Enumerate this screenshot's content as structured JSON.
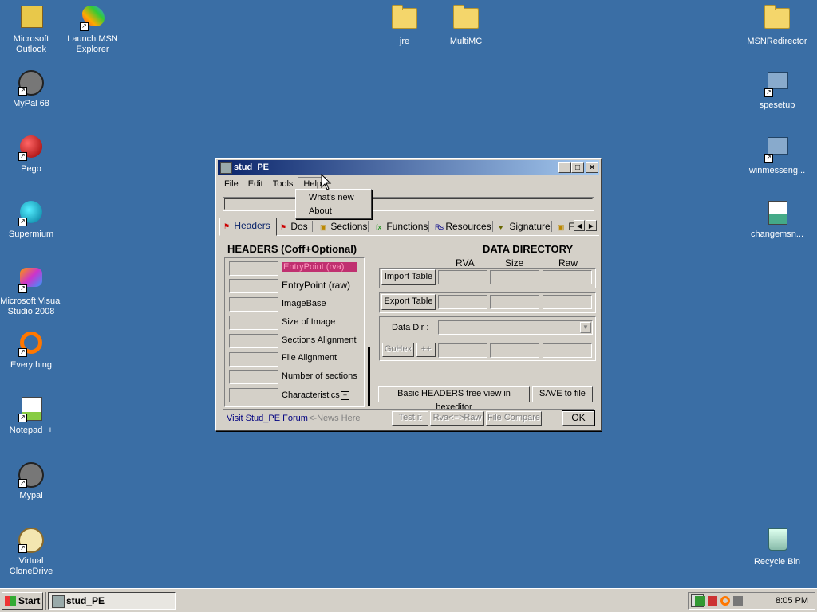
{
  "desktop": {
    "icons_left": [
      {
        "label": "Microsoft Outlook",
        "icon": "outlook-icon"
      },
      {
        "label": "Launch MSN Explorer",
        "icon": "msn-butterfly-icon"
      },
      {
        "label": "MyPal 68",
        "icon": "raccoon-icon"
      },
      {
        "label": "Pego",
        "icon": "red-ball-icon"
      },
      {
        "label": "Supermium",
        "icon": "supermium-icon"
      },
      {
        "label": "Microsoft Visual Studio 2008",
        "icon": "visual-studio-icon"
      },
      {
        "label": "Everything",
        "icon": "magnifier-icon"
      },
      {
        "label": "Notepad++",
        "icon": "notepadpp-icon"
      },
      {
        "label": "Mypal",
        "icon": "raccoon-icon"
      },
      {
        "label": "Virtual CloneDrive",
        "icon": "sheep-icon"
      }
    ],
    "icons_top": [
      {
        "label": "jre",
        "icon": "folder-icon"
      },
      {
        "label": "MultiMC",
        "icon": "folder-icon"
      }
    ],
    "icons_right": [
      {
        "label": "MSNRedirector",
        "icon": "folder-icon"
      },
      {
        "label": "spesetup",
        "icon": "installer-icon"
      },
      {
        "label": "winmesseng...",
        "icon": "installer-icon"
      },
      {
        "label": "changemsn...",
        "icon": "script-icon"
      },
      {
        "label": "Recycle Bin",
        "icon": "recycle-bin-icon"
      }
    ]
  },
  "window": {
    "title": "stud_PE",
    "controls": {
      "minimize": "_",
      "maximize": "□",
      "close": "×"
    },
    "menu": [
      "File",
      "Edit",
      "Tools",
      "Help"
    ],
    "help_menu": [
      "What's new",
      "About"
    ],
    "tabs": [
      "Headers",
      "Dos",
      "Sections",
      "Functions",
      "Resources",
      "Signature",
      "F"
    ],
    "headers_title": "HEADERS (Coff+Optional)",
    "header_fields": [
      "EntryPoint (rva)",
      "EntryPoint (raw)",
      "ImageBase",
      "Size of Image",
      "Sections Alignment",
      "File Alignment",
      "Number of sections",
      "Characteristics"
    ],
    "characteristics_expand": "+",
    "data_directory_title": "DATA  DIRECTORY",
    "dd_columns": [
      "RVA",
      "Size",
      "Raw"
    ],
    "import_table": "Import Table",
    "export_table": "Export Table",
    "data_dir_label": "Data Dir :",
    "gohex": "GoHex",
    "plusplus": "++",
    "basic_headers_btn": "Basic HEADERS tree view in hexeditor",
    "save_btn": "SAVE to file",
    "forum_link": "Visit Stud_PE Forum",
    "news": "<-News Here",
    "test_btn": "Test it",
    "rva_raw_btn": "Rva<=>Raw",
    "file_compare_btn": "File Compare",
    "ok_btn": "OK"
  },
  "taskbar": {
    "start": "Start",
    "task": "stud_PE",
    "clock": "8:05 PM"
  }
}
